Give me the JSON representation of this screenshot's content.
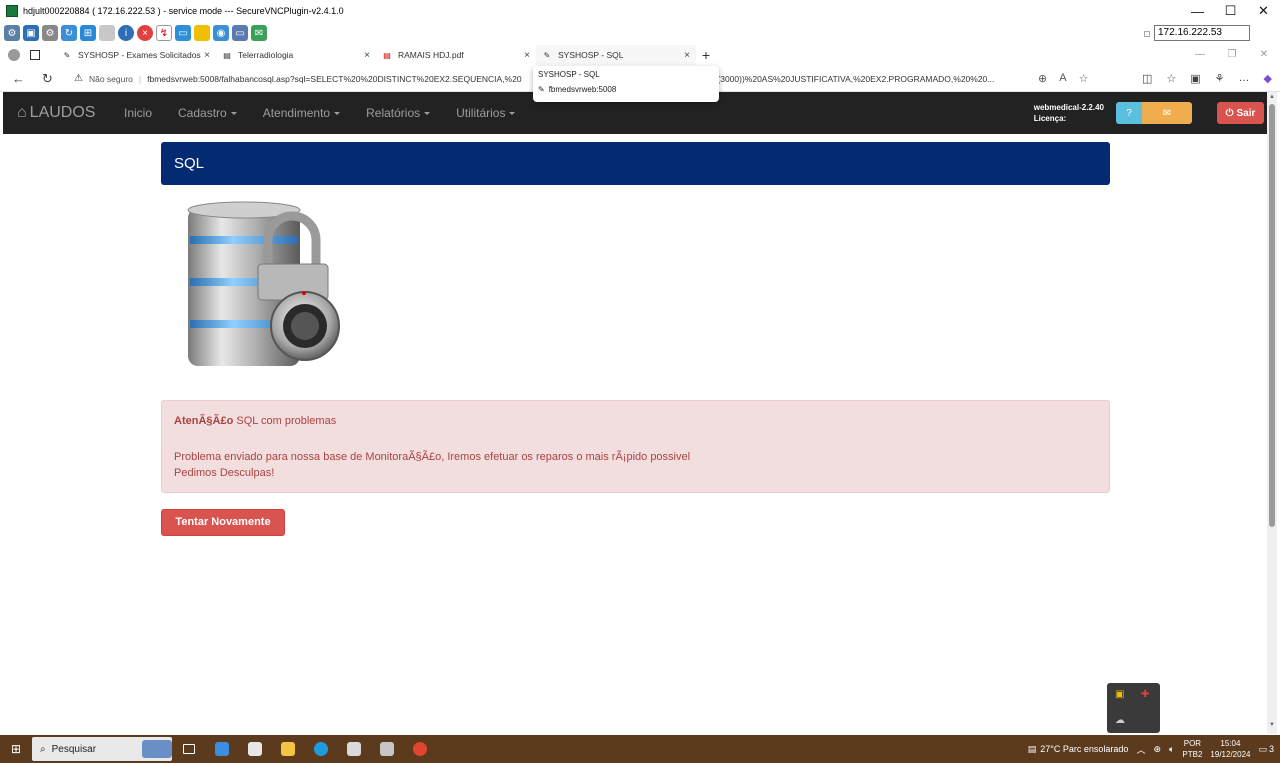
{
  "vnc": {
    "title": "hdjult000220884 ( 172.16.222.53 ) - service mode --- SecureVNCPlugin-v2.4.1.0",
    "address": "172.16.222.53"
  },
  "tabs": [
    {
      "label": "SYSHOSP - Exames Solicitados"
    },
    {
      "label": "Telerradiologia"
    },
    {
      "label": "RAMAIS HDJ.pdf"
    },
    {
      "label": "SYSHOSP - SQL"
    }
  ],
  "tooltip": {
    "title": "SYSHOSP - SQL",
    "host": "fbmedsvrweb:5008"
  },
  "addressbar": {
    "security": "Não seguro",
    "url": "fbmedsvrweb:5008/falhabancosql.asp?sql=SELECT%20%20DISTINCT%20EX2.SEQUENCIA,%20",
    "url_tail": "AR(3000))%20AS%20JUSTIFICATIVA,%20EX2.PROGRAMADO,%20%20..."
  },
  "navbar": {
    "brand": "LAUDOS",
    "items": [
      {
        "label": "Inicio",
        "dropdown": false
      },
      {
        "label": "Cadastro",
        "dropdown": true
      },
      {
        "label": "Atendimento",
        "dropdown": true
      },
      {
        "label": "Relatórios",
        "dropdown": true
      },
      {
        "label": "Utilitários",
        "dropdown": true
      }
    ],
    "version": "webmedical-2.2.40",
    "license": "Licença:",
    "help": "?",
    "logout": "Sair"
  },
  "page": {
    "heading": "SQL",
    "alert": {
      "strong": "AtenÃ§Ã£o",
      "rest": " SQL com problemas",
      "line2": "Problema enviado para nossa base de MonitoraÃ§Ã£o, Iremos efetuar os reparos o mais rÃ¡pido possivel",
      "line3": "Pedimos Desculpas!"
    },
    "retry_button": "Tentar Novamente"
  },
  "taskbar": {
    "search_placeholder": "Pesquisar",
    "weather": "27°C  Parc ensolarado",
    "lang1": "POR",
    "lang2": "PTB2",
    "time": "15:04",
    "date": "19/12/2024",
    "notif_count": "3"
  },
  "colors": {
    "panel_header": "#042a72",
    "navbar": "#222222",
    "danger": "#d9534f",
    "alert_bg": "#f2dede",
    "taskbar": "#5b3a1e"
  }
}
